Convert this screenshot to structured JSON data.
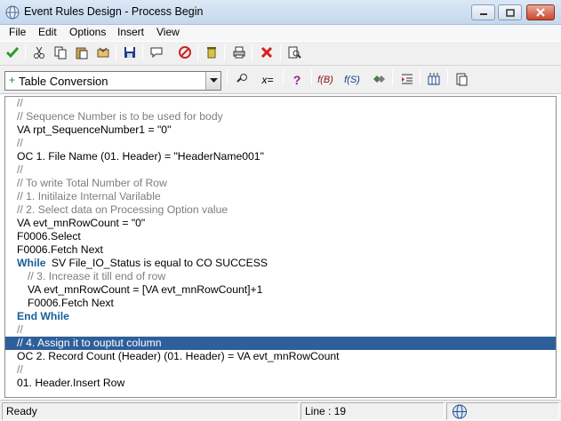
{
  "window": {
    "title": "Event Rules Design - Process Begin",
    "icon": "globe-icon",
    "controls": {
      "minimize": "minimize-icon",
      "maximize": "maximize-icon",
      "close": "close-icon"
    }
  },
  "menu": {
    "items": [
      {
        "label": "File"
      },
      {
        "label": "Edit"
      },
      {
        "label": "Options"
      },
      {
        "label": "Insert"
      },
      {
        "label": "View"
      }
    ]
  },
  "toolbar": {
    "buttons": [
      {
        "icon": "checkmark-icon",
        "color": "#2e9a2e"
      },
      {
        "icon": "cut-icon"
      },
      {
        "icon": "copy-icon"
      },
      {
        "icon": "paste-icon"
      },
      {
        "icon": "insert-special-icon"
      },
      {
        "icon": "save-icon"
      },
      {
        "icon": "comment-bubble-icon"
      },
      {
        "icon": "disable-icon",
        "color": "#cc2222"
      },
      {
        "icon": "delete-trash-icon"
      },
      {
        "icon": "print-icon"
      },
      {
        "icon": "cancel-x-icon",
        "color": "#dd1c1c"
      },
      {
        "icon": "search-page-icon"
      }
    ]
  },
  "event_selector": {
    "value": "Table Conversion",
    "marker": "+"
  },
  "toolbar2": {
    "buttons": [
      {
        "icon": "find-icon"
      },
      {
        "icon": "assignment-icon",
        "label": "x="
      },
      {
        "icon": "help-question-icon",
        "label": "?"
      },
      {
        "icon": "function-icon",
        "label": "f(B)"
      },
      {
        "icon": "system-function-icon",
        "label": "f(S)"
      },
      {
        "icon": "variables-icon"
      },
      {
        "icon": "indent-icon"
      },
      {
        "icon": "columns-icon"
      },
      {
        "icon": "clipboard-icon"
      }
    ]
  },
  "code": {
    "lines": [
      {
        "text": "//",
        "type": "comment",
        "indent": 0
      },
      {
        "text": "// Sequence Number is to be used for body",
        "type": "comment",
        "indent": 0
      },
      {
        "text": "VA rpt_SequenceNumber1 = \"0\"",
        "type": "normal",
        "indent": 0
      },
      {
        "text": "//",
        "type": "comment",
        "indent": 0
      },
      {
        "text": "OC 1. File Name (01. Header) = \"HeaderName001\"",
        "type": "normal",
        "indent": 0
      },
      {
        "text": "//",
        "type": "comment",
        "indent": 0
      },
      {
        "text": "// To write Total Number of Row",
        "type": "comment",
        "indent": 0
      },
      {
        "text": "// 1. Initilaize Internal Varilable",
        "type": "comment",
        "indent": 0
      },
      {
        "text": "// 2. Select data on Processing Option value",
        "type": "comment",
        "indent": 0
      },
      {
        "text": "VA evt_mnRowCount = \"0\"",
        "type": "normal",
        "indent": 0
      },
      {
        "text": "F0006.Select",
        "type": "normal",
        "indent": 0
      },
      {
        "text": "F0006.Fetch Next",
        "type": "normal",
        "indent": 0
      },
      {
        "keyword": "While",
        "text": " SV File_IO_Status is equal to CO SUCCESS",
        "type": "keyword-line",
        "indent": 0
      },
      {
        "text": "// 3. Increase it till end of row",
        "type": "comment",
        "indent": 1
      },
      {
        "text": "VA evt_mnRowCount = [VA evt_mnRowCount]+1",
        "type": "normal",
        "indent": 1
      },
      {
        "text": "F0006.Fetch Next",
        "type": "normal",
        "indent": 1
      },
      {
        "keyword": "End While",
        "text": "",
        "type": "keyword-line",
        "indent": 0
      },
      {
        "text": "//",
        "type": "comment",
        "indent": 0
      },
      {
        "text": "// 4. Assign it to ouptut column",
        "type": "comment",
        "indent": 0,
        "selected": true
      },
      {
        "text": "OC 2. Record Count (Header) (01. Header) = VA evt_mnRowCount",
        "type": "normal",
        "indent": 0
      },
      {
        "text": "//",
        "type": "comment",
        "indent": 0
      },
      {
        "text": "01. Header.Insert Row",
        "type": "normal",
        "indent": 0
      }
    ]
  },
  "status": {
    "state": "Ready",
    "line": "Line : 19",
    "globe_icon": "globe-icon"
  },
  "colors": {
    "selection": "#2f5f9a",
    "keyword": "#1a5f97",
    "comment": "#7d7d7d"
  }
}
